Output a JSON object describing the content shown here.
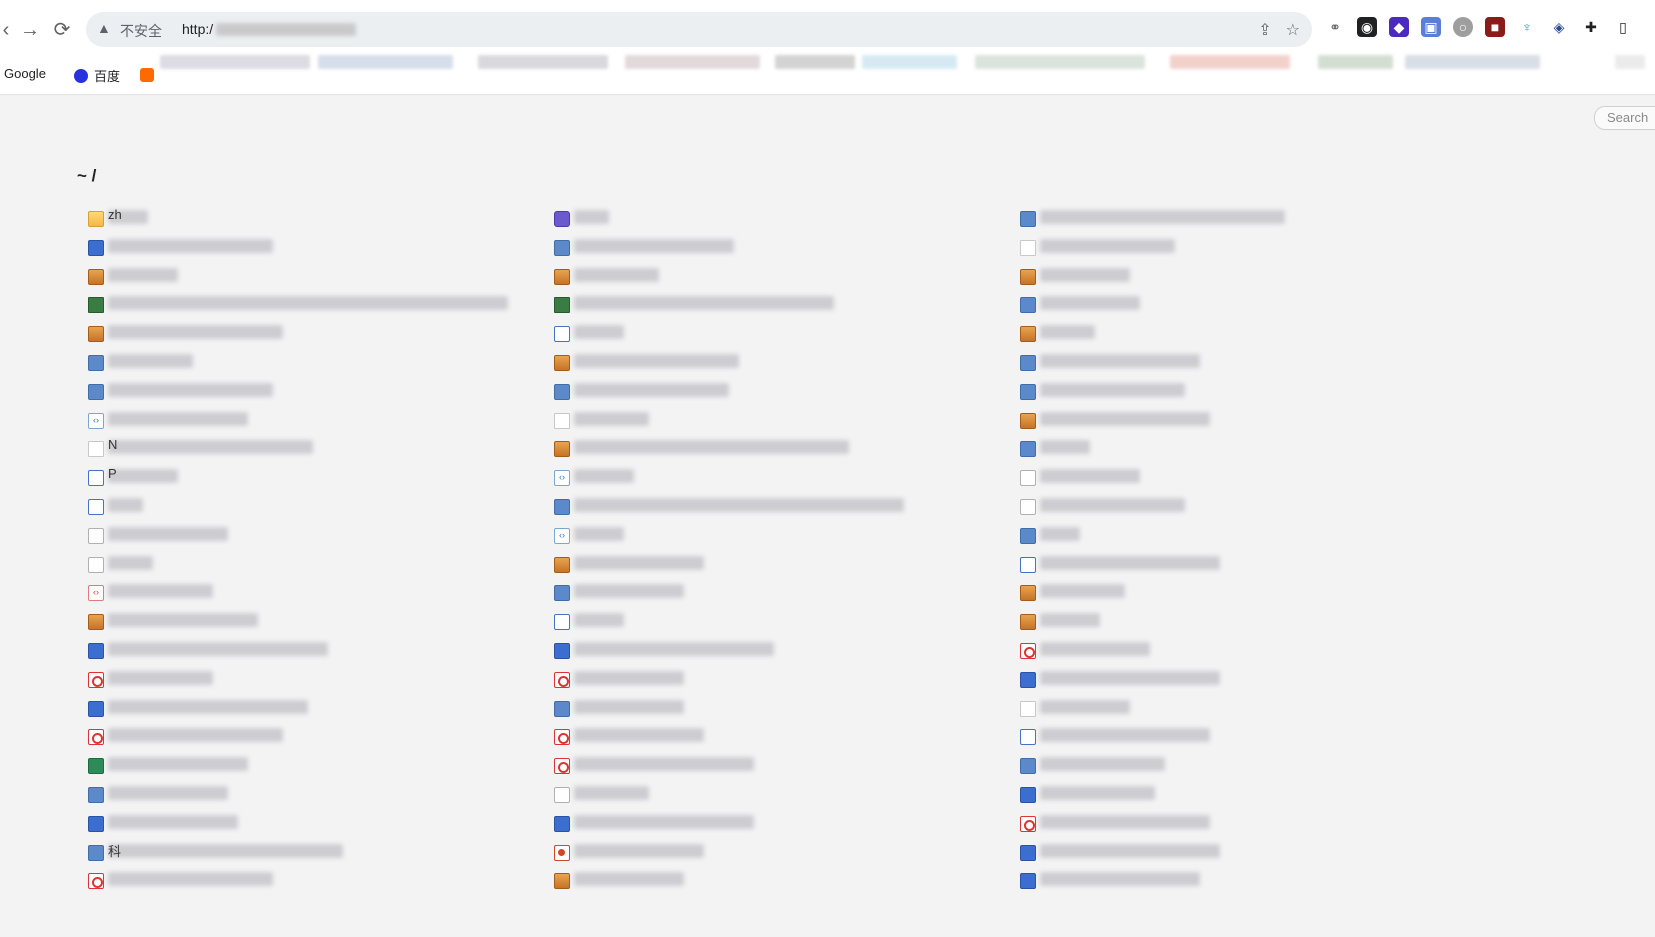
{
  "browser": {
    "security_label": "不安全",
    "url_prefix": "http:/",
    "bookmarks": [
      {
        "label": "Google",
        "color": "#4285f4"
      },
      {
        "label": "百度",
        "color": "#2932e1"
      }
    ],
    "extension_icons": [
      "extension-icon-1",
      "extension-icon-2",
      "extension-icon-3",
      "extension-icon-4",
      "extension-icon-5",
      "extension-icon-6",
      "extension-icon-7",
      "extension-icon-8"
    ]
  },
  "page": {
    "search_placeholder": "Search",
    "breadcrumb": "~ /",
    "columns": [
      {
        "items": [
          {
            "icon": "folder",
            "text": "zh",
            "w": 40
          },
          {
            "icon": "doc",
            "text": "",
            "w": 165
          },
          {
            "icon": "box",
            "text": "",
            "w": 70
          },
          {
            "icon": "video",
            "text": "",
            "w": 400
          },
          {
            "icon": "box",
            "text": "",
            "w": 175
          },
          {
            "icon": "img",
            "text": "",
            "w": 85
          },
          {
            "icon": "img",
            "text": "",
            "w": 165
          },
          {
            "icon": "code",
            "text": "",
            "w": 140
          },
          {
            "icon": "file",
            "text": "N",
            "w": 205
          },
          {
            "icon": "win",
            "text": "P",
            "w": 70
          },
          {
            "icon": "win",
            "text": "",
            "w": 35
          },
          {
            "icon": "text",
            "text": "",
            "w": 120
          },
          {
            "icon": "text",
            "text": "",
            "w": 45
          },
          {
            "icon": "codered",
            "text": "",
            "w": 105
          },
          {
            "icon": "box",
            "text": "",
            "w": 150
          },
          {
            "icon": "doc",
            "text": "",
            "w": 220
          },
          {
            "icon": "pdf",
            "text": "",
            "w": 105
          },
          {
            "icon": "doc",
            "text": "",
            "w": 200
          },
          {
            "icon": "pdf",
            "text": "",
            "w": 175
          },
          {
            "icon": "sheet",
            "text": "",
            "w": 140
          },
          {
            "icon": "img",
            "text": "",
            "w": 120
          },
          {
            "icon": "doc",
            "text": "",
            "w": 130
          },
          {
            "icon": "img",
            "text": "科",
            "w": 235
          },
          {
            "icon": "pdf",
            "text": "",
            "w": 165
          }
        ]
      },
      {
        "items": [
          {
            "icon": "app",
            "text": "",
            "w": 35
          },
          {
            "icon": "img",
            "text": "",
            "w": 160
          },
          {
            "icon": "box",
            "text": "",
            "w": 85
          },
          {
            "icon": "video",
            "text": "",
            "w": 260
          },
          {
            "icon": "win",
            "text": "",
            "w": 50
          },
          {
            "icon": "box",
            "text": "",
            "w": 165
          },
          {
            "icon": "img",
            "text": "",
            "w": 155
          },
          {
            "icon": "file",
            "text": "",
            "w": 75
          },
          {
            "icon": "box",
            "text": "",
            "w": 275
          },
          {
            "icon": "code",
            "text": "",
            "w": 60
          },
          {
            "icon": "img",
            "text": "",
            "w": 330
          },
          {
            "icon": "code",
            "text": "",
            "w": 50
          },
          {
            "icon": "box",
            "text": "",
            "w": 130
          },
          {
            "icon": "img",
            "text": "",
            "w": 110
          },
          {
            "icon": "win",
            "text": "",
            "w": 50
          },
          {
            "icon": "doc",
            "text": "",
            "w": 200
          },
          {
            "icon": "pdf",
            "text": "",
            "w": 110
          },
          {
            "icon": "img",
            "text": "",
            "w": 110
          },
          {
            "icon": "pdf",
            "text": "",
            "w": 130
          },
          {
            "icon": "pdf",
            "text": "",
            "w": 180
          },
          {
            "icon": "text",
            "text": "",
            "w": 75
          },
          {
            "icon": "doc",
            "text": "",
            "w": 180
          },
          {
            "icon": "ppt",
            "text": "",
            "w": 130
          },
          {
            "icon": "box",
            "text": "",
            "w": 110
          }
        ]
      },
      {
        "items": [
          {
            "icon": "img",
            "text": "",
            "w": 245
          },
          {
            "icon": "file",
            "text": "",
            "w": 135
          },
          {
            "icon": "box",
            "text": "",
            "w": 90
          },
          {
            "icon": "img",
            "text": "",
            "w": 100
          },
          {
            "icon": "box",
            "text": "",
            "w": 55
          },
          {
            "icon": "img",
            "text": "",
            "w": 160
          },
          {
            "icon": "img",
            "text": "",
            "w": 145
          },
          {
            "icon": "box",
            "text": "",
            "w": 170
          },
          {
            "icon": "img",
            "text": "",
            "w": 50
          },
          {
            "icon": "text",
            "text": "",
            "w": 100
          },
          {
            "icon": "text",
            "text": "",
            "w": 145
          },
          {
            "icon": "img",
            "text": "",
            "w": 40
          },
          {
            "icon": "win",
            "text": "",
            "w": 180
          },
          {
            "icon": "box",
            "text": "",
            "w": 85
          },
          {
            "icon": "box",
            "text": "",
            "w": 60
          },
          {
            "icon": "pdf",
            "text": "",
            "w": 110
          },
          {
            "icon": "doc",
            "text": "",
            "w": 180
          },
          {
            "icon": "file",
            "text": "",
            "w": 90
          },
          {
            "icon": "win",
            "text": "",
            "w": 170
          },
          {
            "icon": "img",
            "text": "",
            "w": 125
          },
          {
            "icon": "doc",
            "text": "",
            "w": 115
          },
          {
            "icon": "pdf",
            "text": "",
            "w": 170
          },
          {
            "icon": "doc",
            "text": "",
            "w": 180
          },
          {
            "icon": "doc",
            "text": "",
            "w": 160
          }
        ]
      }
    ]
  }
}
